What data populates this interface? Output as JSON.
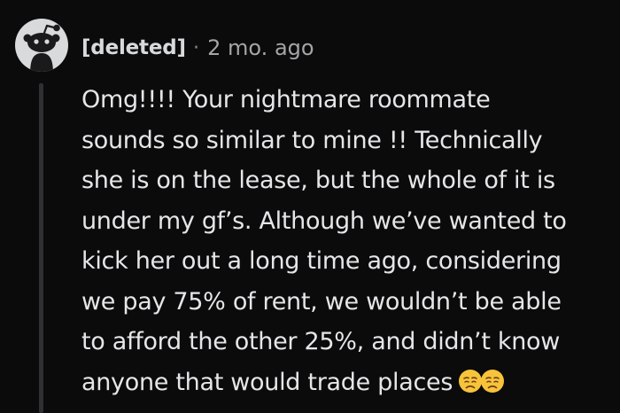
{
  "comment": {
    "author": "[deleted]",
    "separator": "·",
    "timestamp": "2 mo. ago",
    "body_lines": [
      "Omg!!!! Your nightmare roommate",
      "sounds so similar to mine !! Technically",
      "she is on the lease, but the whole of it is",
      "under my gf’s. Although we’ve wanted to",
      "kick her out a long time ago, considering",
      "we pay 75% of rent, we wouldn’t be able",
      "to afford the other 25%, and didn’t know",
      "anyone that would trade places"
    ],
    "emojis": [
      "disappointed-face-emoji",
      "disappointed-face-emoji"
    ]
  }
}
